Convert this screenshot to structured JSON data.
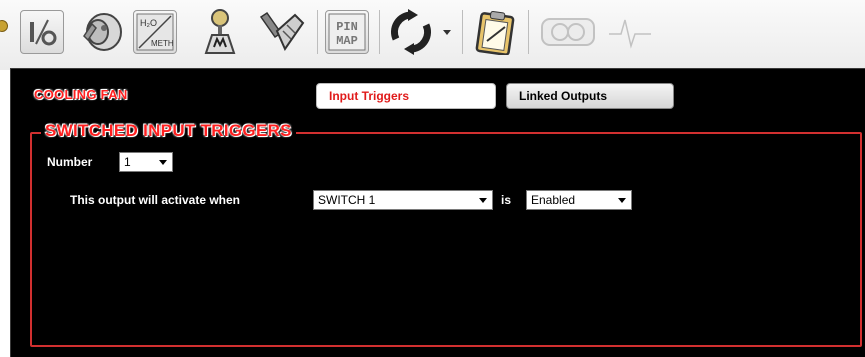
{
  "toolbar": {
    "icons": [
      {
        "name": "input-output-icon",
        "text": "I/O"
      },
      {
        "name": "cam-sensor-icon"
      },
      {
        "name": "water-methanol-icon",
        "text_top": "H2O",
        "text_bottom": "METH"
      },
      {
        "name": "shifter-icon"
      },
      {
        "name": "pedal-icon"
      },
      {
        "name": "pin-map-icon",
        "line1": "PIN",
        "line2": "MAP"
      },
      {
        "name": "refresh-icon"
      },
      {
        "name": "clipboard-icon"
      },
      {
        "name": "gauge-icon"
      },
      {
        "name": "waveform-icon"
      }
    ]
  },
  "panel": {
    "section_title": "COOLING FAN",
    "tabs": {
      "input_triggers": "Input Triggers",
      "linked_outputs": "Linked Outputs"
    },
    "group_title": "SWITCHED INPUT TRIGGERS",
    "number_label": "Number",
    "number_value": "1",
    "activate_label": "This output will activate when",
    "switch_value": "SWITCH 1",
    "is_label": "is",
    "state_value": "Enabled"
  },
  "colors": {
    "accent_red": "#ff2020",
    "panel_bg": "#000000",
    "group_border": "#d23030"
  }
}
